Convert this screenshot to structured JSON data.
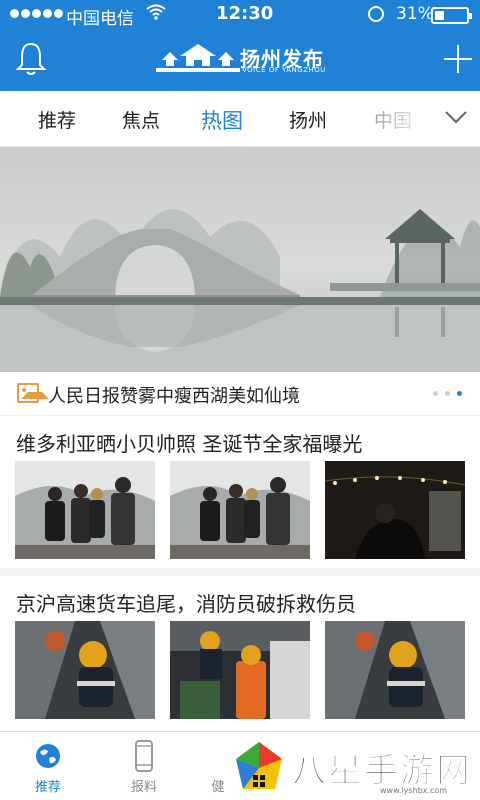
{
  "status": {
    "carrier": "中国电信",
    "time": "12:30",
    "battery_pct": "31%",
    "battery_level": 0.31,
    "signal_dots": 5
  },
  "header": {
    "logo_title": "扬州发布",
    "logo_sub": "VOICE OF YANGZHOU",
    "left_icon": "bell-icon",
    "right_icon": "plus-icon"
  },
  "tabs": [
    {
      "label": "推荐"
    },
    {
      "label": "焦点"
    },
    {
      "label": "热图",
      "active": true
    },
    {
      "label": "扬州"
    },
    {
      "label": "中国"
    }
  ],
  "hero": {
    "caption": "人民日报赞雾中瘦西湖美如仙境",
    "dots": 3,
    "active_dot": 2
  },
  "news": [
    {
      "title": "维多利亚晒小贝帅照 圣诞节全家福曝光"
    },
    {
      "title": "京沪高速货车追尾，消防员破拆救伤员"
    }
  ],
  "bottom_nav": [
    {
      "label": "推荐",
      "icon": "globe-icon",
      "active": true
    },
    {
      "label": "报料",
      "icon": "phone-icon"
    },
    {
      "label": "健",
      "icon": "health-icon"
    }
  ],
  "watermark": {
    "text": "八星手游网",
    "url": "www.lyshbx.com"
  },
  "colors": {
    "primary": "#1f82d6",
    "accent_orange": "#e89a3c"
  }
}
